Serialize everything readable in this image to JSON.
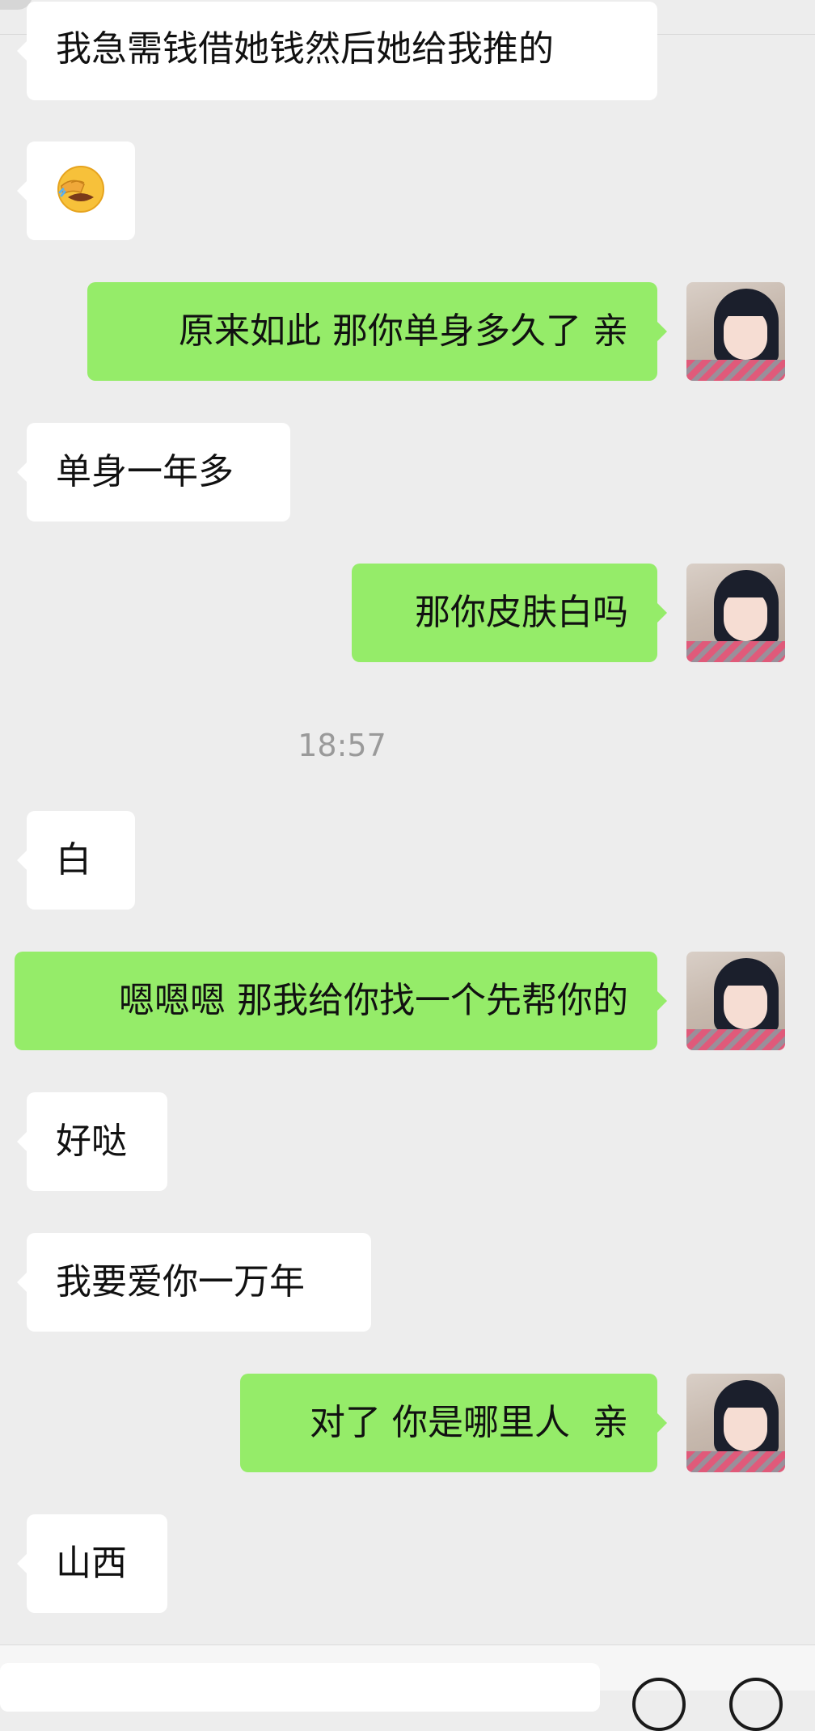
{
  "messages": [
    {
      "side": "left",
      "text": "我急需钱借她钱然后她给我推的"
    },
    {
      "side": "left",
      "text": "",
      "icon": "face-with-hand-over-eyes-emoji"
    },
    {
      "side": "right",
      "text": "原来如此 那你单身多久了 亲"
    },
    {
      "side": "left",
      "text": "单身一年多"
    },
    {
      "side": "right",
      "text": "那你皮肤白吗"
    },
    {
      "side": "left",
      "text": "白"
    },
    {
      "side": "right",
      "text": "嗯嗯嗯 那我给你找一个先帮你的"
    },
    {
      "side": "left",
      "text": "好哒"
    },
    {
      "side": "left",
      "text": "我要爱你一万年"
    },
    {
      "side": "right",
      "text": "对了 你是哪里人  亲"
    },
    {
      "side": "left",
      "text": "山西"
    }
  ],
  "timestamp": "18:57",
  "colors": {
    "background": "#ededed",
    "incoming": "#ffffff",
    "outgoing": "#95ec69",
    "timestamp": "#9a9a9a"
  },
  "input_bar": {
    "icons": [
      "voice-icon",
      "emoji-icon",
      "plus-icon"
    ]
  }
}
